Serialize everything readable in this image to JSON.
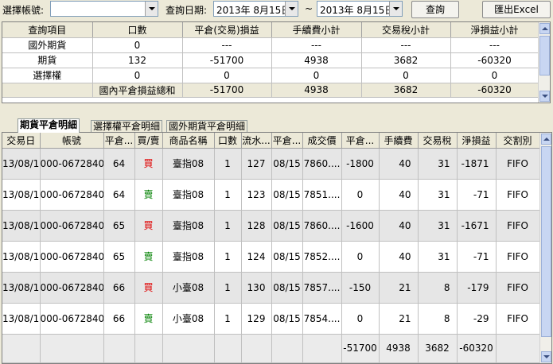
{
  "toolbar": {
    "account_label": "選擇帳號:",
    "account_value": "",
    "date_label": "查詢日期:",
    "date_from": "2013年  8月15日",
    "date_sep": "~",
    "date_to": "2013年  8月15日",
    "query_button": "查詢",
    "export_button": "匯出Excel"
  },
  "summary": {
    "headers": [
      "查詢項目",
      "口數",
      "平倉(交易)損益",
      "手續費小計",
      "交易稅小計",
      "淨損益小計"
    ],
    "rows": [
      [
        "國外期貨",
        "0",
        "---",
        "---",
        "---",
        "---"
      ],
      [
        "期貨",
        "132",
        "-51700",
        "4938",
        "3682",
        "-60320"
      ],
      [
        "選擇權",
        "0",
        "0",
        "0",
        "0",
        "0"
      ]
    ],
    "total": [
      "",
      "國內平倉損益總和",
      "-51700",
      "4938",
      "3682",
      "-60320"
    ]
  },
  "tabs": [
    "期貨平倉明細",
    "選擇權平倉明細",
    "國外期貨平倉明細"
  ],
  "detail": {
    "headers": [
      "交易日",
      "帳號",
      "平倉...",
      "買/賣",
      "商品名稱",
      "口數",
      "流水...",
      "平倉...",
      "成交價",
      "平倉...",
      "手續費",
      "交易稅",
      "淨損益",
      "交割別"
    ],
    "rows": [
      [
        "13/08/15",
        "000-0672840",
        "64",
        "買",
        "臺指08",
        "1",
        "127",
        "08/15",
        "7860....",
        "-1800",
        "40",
        "31",
        "-1871",
        "FIFO"
      ],
      [
        "13/08/15",
        "000-0672840",
        "64",
        "賣",
        "臺指08",
        "1",
        "123",
        "08/15",
        "7851....",
        "0",
        "40",
        "31",
        "-71",
        "FIFO"
      ],
      [
        "13/08/15",
        "000-0672840",
        "65",
        "買",
        "臺指08",
        "1",
        "128",
        "08/15",
        "7860....",
        "-1600",
        "40",
        "31",
        "-1671",
        "FIFO"
      ],
      [
        "13/08/15",
        "000-0672840",
        "65",
        "賣",
        "臺指08",
        "1",
        "124",
        "08/15",
        "7852....",
        "0",
        "40",
        "31",
        "-71",
        "FIFO"
      ],
      [
        "13/08/15",
        "000-0672840",
        "66",
        "買",
        "小臺08",
        "1",
        "130",
        "08/15",
        "7857....",
        "-150",
        "21",
        "8",
        "-179",
        "FIFO"
      ],
      [
        "13/08/15",
        "000-0672840",
        "66",
        "賣",
        "小臺08",
        "1",
        "129",
        "08/15",
        "7854....",
        "0",
        "21",
        "8",
        "-29",
        "FIFO"
      ]
    ],
    "total": [
      "",
      "",
      "",
      "",
      "",
      "",
      "",
      "",
      "",
      "-51700",
      "4938",
      "3682",
      "-60320",
      ""
    ]
  },
  "colors": {
    "buy": "#e00000",
    "sell": "#008000",
    "window": "#ece9d8"
  }
}
